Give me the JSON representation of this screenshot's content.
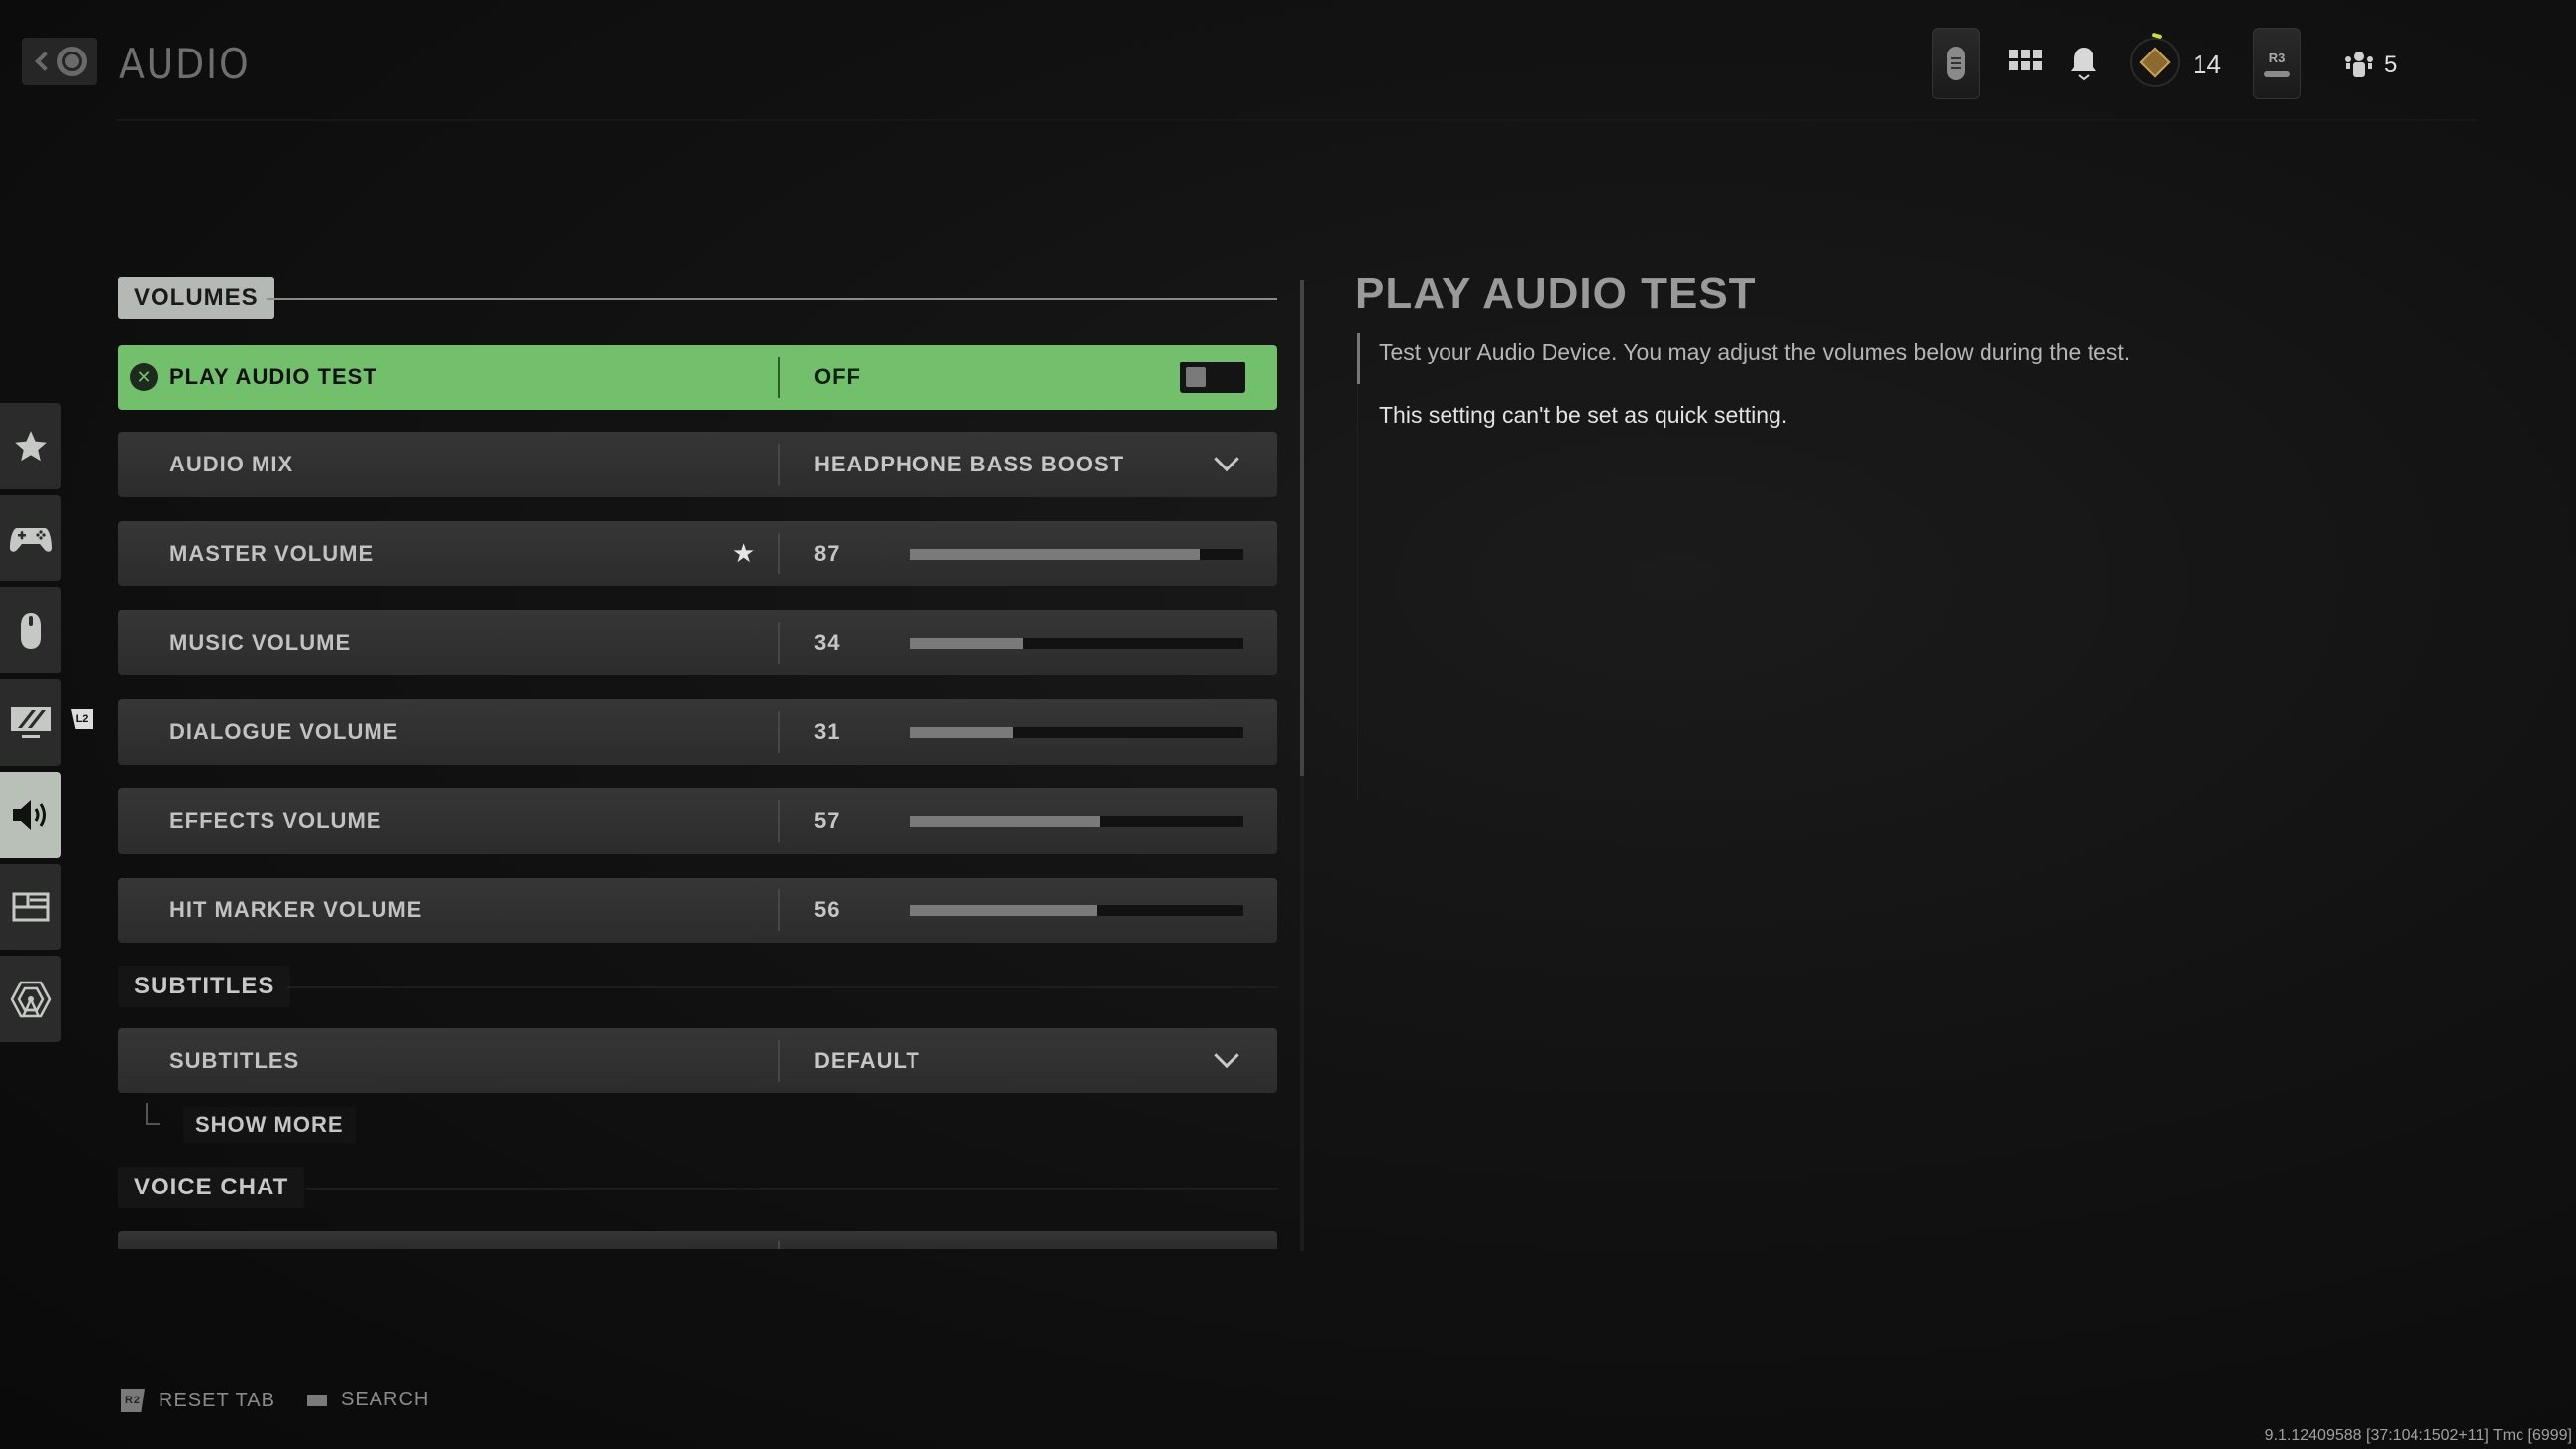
{
  "header": {
    "title": "AUDIO",
    "back_icon": "back-circle-icon",
    "level": "14",
    "r3_label": "R3",
    "party_count": "5"
  },
  "sidebar": {
    "items": [
      {
        "name": "favorites",
        "icon": "star-icon",
        "active": false
      },
      {
        "name": "controller",
        "icon": "gamepad-icon",
        "active": false
      },
      {
        "name": "mouse-keyboard",
        "icon": "mouse-icon",
        "active": false
      },
      {
        "name": "graphics",
        "icon": "monitor-icon",
        "active": false
      },
      {
        "name": "audio",
        "icon": "speaker-icon",
        "active": true
      },
      {
        "name": "interface",
        "icon": "layout-icon",
        "active": false
      },
      {
        "name": "account-network",
        "icon": "network-tower-icon",
        "active": false
      }
    ],
    "l2_badge": "L2"
  },
  "sections": {
    "volumes": "VOLUMES",
    "subtitles": "SUBTITLES",
    "voice_chat": "VOICE CHAT"
  },
  "settings": {
    "play_audio_test": {
      "label": "PLAY AUDIO TEST",
      "value": "OFF",
      "toggle_on": false
    },
    "audio_mix": {
      "label": "AUDIO MIX",
      "value": "HEADPHONE BASS BOOST"
    },
    "volumes": [
      {
        "label": "MASTER VOLUME",
        "value": 87,
        "favorite": true
      },
      {
        "label": "MUSIC VOLUME",
        "value": 34,
        "favorite": false
      },
      {
        "label": "DIALOGUE VOLUME",
        "value": 31,
        "favorite": false
      },
      {
        "label": "EFFECTS VOLUME",
        "value": 57,
        "favorite": false
      },
      {
        "label": "HIT MARKER VOLUME",
        "value": 56,
        "favorite": false
      }
    ],
    "volume_max": 100,
    "subtitles": {
      "label": "SUBTITLES",
      "value": "DEFAULT"
    },
    "show_more": "SHOW MORE"
  },
  "scroll": {
    "position": 0.0,
    "visible_fraction": 0.51
  },
  "detail": {
    "title": "PLAY AUDIO TEST",
    "description": "Test your Audio Device. You may adjust the volumes below during the test.",
    "note": "This setting can't be set as quick setting."
  },
  "footer": {
    "reset_icon": "R2",
    "reset_label": "RESET TAB",
    "search_label": "SEARCH"
  },
  "build_info": "9.1.12409588 [37:104:1502+11] Tmc [6999]",
  "colors": {
    "highlight": "#72c06c",
    "active_tab": "#b8c0b8",
    "rank_accent": "#c8e030"
  }
}
